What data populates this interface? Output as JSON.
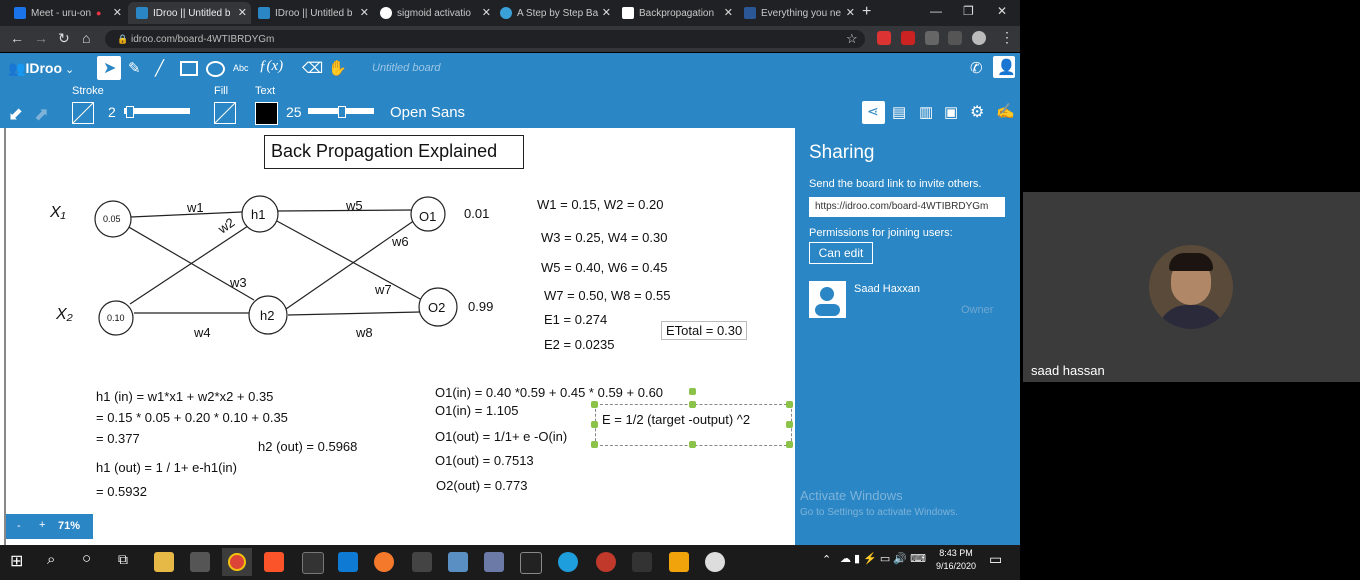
{
  "browser": {
    "tabs": [
      {
        "title": "Meet - uru-on",
        "color": "#1a73e8"
      },
      {
        "title": "IDroo || Untitled b",
        "color": "#2a86c4",
        "active": true
      },
      {
        "title": "IDroo || Untitled b",
        "color": "#2a86c4"
      },
      {
        "title": "sigmoid activatio",
        "color": "#ffffff"
      },
      {
        "title": "A Step by Step Ba",
        "color": "#3aa0d8"
      },
      {
        "title": "Backpropagation",
        "color": "#ffffff"
      },
      {
        "title": "Everything you ne",
        "color": "#2b5797"
      }
    ],
    "new_tab": "+",
    "url": "idroo.com/board-4WTIBRDYGm"
  },
  "app": {
    "logo": "IDroo",
    "board_title": "Untitled board",
    "stroke_label": "Stroke",
    "stroke_value": "2",
    "fill_label": "Fill",
    "text_label": "Text",
    "text_value": "25",
    "font_name": "Open Sans",
    "zoom": "71%",
    "zoom_minus": "-",
    "zoom_plus": "+"
  },
  "board": {
    "title": "Back Propagation Explained",
    "x1": "X₁",
    "x2": "X₂",
    "nodes": {
      "i1": "0.05",
      "i2": "0.10",
      "h1": "h1",
      "h2": "h2",
      "o1": "O1",
      "o2": "O2"
    },
    "outputs": {
      "o1": "0.01",
      "o2": "0.99"
    },
    "weights": {
      "w1": "w1",
      "w2": "w2",
      "w3": "w3",
      "w4": "w4",
      "w5": "w5",
      "w6": "w6",
      "w7": "w7",
      "w8": "w8"
    },
    "weight_values": [
      "W1 = 0.15,    W2 = 0.20",
      "W3 = 0.25,  W4 = 0.30",
      "W5 = 0.40, W6 = 0.45",
      "W7 = 0.50, W8 = 0.55",
      "E1 = 0.274",
      "E2 = 0.0235"
    ],
    "etotal": "ETotal = 0.30",
    "h1_calc": [
      "h1 (in) = w1*x1 + w2*x2 + 0.35",
      "= 0.15 * 0.05 + 0.20 * 0.10 + 0.35",
      "= 0.377",
      "h1 (out) = 1 / 1+ e-h1(in)",
      "= 0.5932"
    ],
    "h2_out": "h2 (out) = 0.5968",
    "o_calc": [
      "O1(in) = 0.40 *0.59 + 0.45 * 0.59 + 0.60",
      "O1(in) = 1.105",
      "O1(out) = 1/1+ e -O(in)",
      "O1(out) =  0.7513",
      "O2(out)  = 0.773"
    ],
    "error_formula": "E = 1/2 (target -output) ^2"
  },
  "sharing": {
    "title": "Sharing",
    "invite_text": "Send the board link to invite others.",
    "link": "https://idroo.com/board-4WTIBRDYGm",
    "permissions_label": "Permissions for joining users:",
    "permission_button": "Can edit",
    "user_name": "Saad Haxxan",
    "user_role": "Owner",
    "activate_title": "Activate Windows",
    "activate_sub": "Go to Settings to activate Windows."
  },
  "taskbar": {
    "time": "8:43 PM",
    "date": "9/16/2020"
  },
  "video": {
    "participant": "saad hassan"
  }
}
